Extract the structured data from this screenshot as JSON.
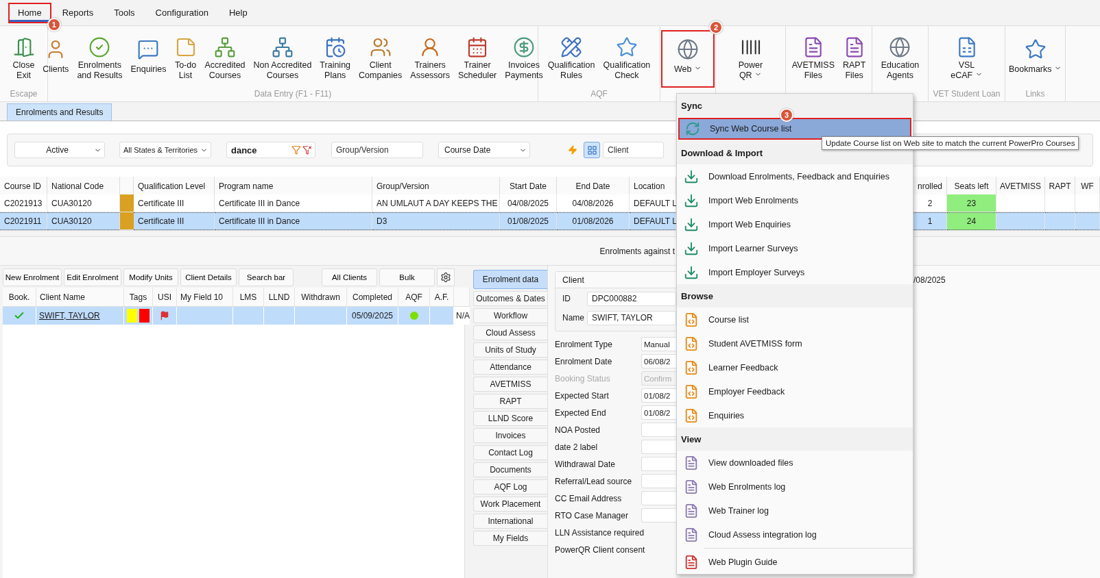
{
  "menu_bar": [
    {
      "label": "Home",
      "selected": true,
      "callout": "1"
    },
    {
      "label": "Reports",
      "selected": false
    },
    {
      "label": "Tools",
      "selected": false
    },
    {
      "label": "Configuration",
      "selected": false
    },
    {
      "label": "Help",
      "selected": false
    }
  ],
  "ribbon": [
    {
      "label": "Escape",
      "buttons": [
        {
          "label": "Close\nExit",
          "dropdown": false
        }
      ]
    },
    {
      "label": "Data Entry (F1 - F11)",
      "buttons": [
        {
          "label": "Clients",
          "dropdown": false
        },
        {
          "label": "Enrolments\nand Results",
          "dropdown": false
        },
        {
          "label": "Enquiries",
          "dropdown": false
        },
        {
          "label": "To-do\nList",
          "dropdown": false
        },
        {
          "label": "Accredited\nCourses",
          "dropdown": false
        },
        {
          "label": "Non Accredited\nCourses",
          "dropdown": false
        },
        {
          "label": "Training\nPlans",
          "dropdown": false
        },
        {
          "label": "Client\nCompanies",
          "dropdown": false
        },
        {
          "label": "Trainers\nAssessors",
          "dropdown": false
        },
        {
          "label": "Trainer\nScheduler",
          "dropdown": false
        },
        {
          "label": "Invoices\nPayments",
          "dropdown": false
        }
      ]
    },
    {
      "label": "AQF",
      "buttons": [
        {
          "label": "Qualification\nRules",
          "dropdown": false
        },
        {
          "label": "Qualification\nCheck",
          "dropdown": false
        }
      ]
    },
    {
      "buttons": [
        {
          "label": "Web",
          "dropdown": true,
          "callout": "2"
        }
      ]
    },
    {
      "buttons": [
        {
          "label": "Power\nQR",
          "dropdown": true
        }
      ]
    },
    {
      "buttons": [
        {
          "label": "AVETMISS\nFiles",
          "dropdown": false
        },
        {
          "label": "RAPT\nFiles",
          "dropdown": false
        }
      ]
    },
    {
      "buttons": [
        {
          "label": "Education\nAgents",
          "dropdown": false
        }
      ]
    },
    {
      "label": "VET Student Loan",
      "buttons": [
        {
          "label": "VSL\neCAF",
          "dropdown": true
        }
      ]
    },
    {
      "label": "Links",
      "buttons": [
        {
          "label": "Bookmarks",
          "dropdown": true
        }
      ]
    }
  ],
  "doc_tabs": [
    {
      "label": "Enrolments and Results",
      "selected": true
    }
  ],
  "filters": {
    "status": "Active",
    "states": "All States & Territories",
    "search": "dance",
    "group_placeholder": "Group/Version",
    "date_field": "Course Date",
    "grid_view_on": true,
    "client_placeholder": "Client"
  },
  "course_table": {
    "columns": [
      "Course ID",
      "National Code",
      "Qualification Level",
      "Program name",
      "Group/Version",
      "Start Date",
      "End Date",
      "Location",
      "nrolled",
      "Seats left",
      "AVETMISS",
      "RAPT",
      "WF"
    ],
    "rows": [
      {
        "selected": false,
        "color": "#d9a021",
        "cells": [
          "C2021913",
          "CUA30120",
          "Certificate III",
          "Certificate III in Dance",
          "AN UMLAUT A DAY KEEPS THE",
          "04/08/2025",
          "04/08/2026",
          "DEFAULT L",
          "2",
          "23",
          null,
          null,
          null
        ]
      },
      {
        "selected": true,
        "color": "#d9a021",
        "cells": [
          "C2021911",
          "CUA30120",
          "Certificate III",
          "Certificate III in Dance",
          "D3",
          "01/08/2025",
          "01/08/2026",
          "DEFAULT L",
          "1",
          "24",
          null,
          null,
          null
        ]
      }
    ]
  },
  "status_text": "Enrolments against t",
  "enrolment_toolbar": {
    "left": [
      "New Enrolment",
      "Edit Enrolment",
      "Modify Units",
      "Client Details",
      "Search bar"
    ],
    "right": [
      "All Clients",
      "Bulk"
    ]
  },
  "enrolment_table": {
    "columns": [
      "Book.",
      "Client Name",
      "Tags",
      "USI",
      "My Field 10",
      "LMS",
      "LLND",
      "Withdrawn",
      "Completed",
      "AQF",
      "A.F."
    ],
    "rows": [
      {
        "selected": true,
        "booked": true,
        "client": "SWIFT, TAYLOR",
        "tags": [
          {
            "color": "#ffff00"
          },
          {
            "color": "#ff0000"
          }
        ],
        "usi_flag": true,
        "completed": "05/09/2025",
        "aqf": {
          "color": "#7ee000"
        },
        "extra": "N/A"
      }
    ]
  },
  "side_tabs": [
    {
      "label": "Enrolment data",
      "selected": true
    },
    {
      "label": "Outcomes & Dates",
      "selected": false
    },
    {
      "label": "Workflow",
      "selected": false
    },
    {
      "label": "Cloud Assess",
      "selected": false
    },
    {
      "label": "Units of Study",
      "selected": false
    },
    {
      "label": "Attendance",
      "selected": false
    },
    {
      "label": "AVETMISS",
      "selected": false
    },
    {
      "label": "RAPT",
      "selected": false
    },
    {
      "label": "LLND Score",
      "selected": false
    },
    {
      "label": "Invoices",
      "selected": false
    },
    {
      "label": "Contact Log",
      "selected": false
    },
    {
      "label": "Documents",
      "selected": false
    },
    {
      "label": "AQF Log",
      "selected": false
    },
    {
      "label": "Work Placement",
      "selected": false
    },
    {
      "label": "International",
      "selected": false
    },
    {
      "label": "My Fields",
      "selected": false
    }
  ],
  "client_box": {
    "title": "Client",
    "fields": [
      {
        "label": "ID",
        "value": "DPC000882"
      },
      {
        "label": "Name",
        "value": "SWIFT, TAYLOR"
      }
    ]
  },
  "form": [
    {
      "kind": "input",
      "label": "Enrolment Type",
      "value": "Manual",
      "disabled": false
    },
    {
      "kind": "input",
      "label": "Enrolment Date",
      "value": "06/08/2",
      "disabled": false
    },
    {
      "kind": "input",
      "label": "Booking Status",
      "value": "Confirm",
      "disabled": true
    },
    {
      "kind": "input",
      "label": "Expected Start",
      "value": "01/08/2",
      "disabled": false
    },
    {
      "kind": "input",
      "label": "Expected End",
      "value": "01/08/2",
      "disabled": false
    },
    {
      "kind": "input",
      "label": "NOA Posted",
      "disabled": false
    },
    {
      "kind": "input",
      "label": "date 2 label",
      "disabled": false
    },
    {
      "kind": "input",
      "label": "Withdrawal Date",
      "disabled": false
    },
    {
      "kind": "input",
      "label": "Referral/Lead source",
      "disabled": false
    },
    {
      "kind": "input",
      "label": "CC Email Address",
      "disabled": false
    },
    {
      "kind": "input",
      "label": "RTO Case Manager",
      "disabled": false
    },
    {
      "kind": "label",
      "label": "LLN Assistance required",
      "disabled": false
    },
    {
      "kind": "label",
      "label": "PowerQR Client consent",
      "disabled": false
    }
  ],
  "right_panel_text": "/08/2025",
  "web_menu": [
    {
      "heading": "Sync",
      "items": [
        {
          "kind": "sync",
          "label": "Sync Web Course list",
          "highlighted": true,
          "callout": "3"
        }
      ]
    },
    {
      "heading": "Download & Import",
      "items": [
        {
          "kind": "download",
          "label": "Download Enrolments, Feedback and Enquiries",
          "highlighted": false
        },
        {
          "kind": "download",
          "label": "Import Web Enrolments",
          "highlighted": false
        },
        {
          "kind": "download",
          "label": "Import Web Enquiries",
          "highlighted": false
        },
        {
          "kind": "download",
          "label": "Import Learner Surveys",
          "highlighted": false
        },
        {
          "kind": "download",
          "label": "Import Employer Surveys",
          "highlighted": false
        }
      ]
    },
    {
      "heading": "Browse",
      "items": [
        {
          "kind": "html",
          "label": "Course list",
          "highlighted": false
        },
        {
          "kind": "html",
          "label": "Student AVETMISS form",
          "highlighted": false
        },
        {
          "kind": "html",
          "label": "Learner Feedback",
          "highlighted": false
        },
        {
          "kind": "html",
          "label": "Employer Feedback",
          "highlighted": false
        },
        {
          "kind": "html",
          "label": "Enquiries",
          "highlighted": false
        }
      ]
    },
    {
      "heading": "View",
      "items": [
        {
          "kind": "log",
          "label": "View downloaded files",
          "highlighted": false
        },
        {
          "kind": "log",
          "label": "Web Enrolments log",
          "highlighted": false
        },
        {
          "kind": "log",
          "label": "Web Trainer log",
          "highlighted": false
        },
        {
          "kind": "log",
          "label": "Cloud Assess integration log",
          "highlighted": false
        }
      ]
    },
    {
      "items": [
        {
          "kind": "pdf",
          "label": "Web Plugin Guide",
          "highlighted": false
        }
      ]
    }
  ],
  "tooltip": "Update Course list on Web site to match the current PowerPro Courses"
}
